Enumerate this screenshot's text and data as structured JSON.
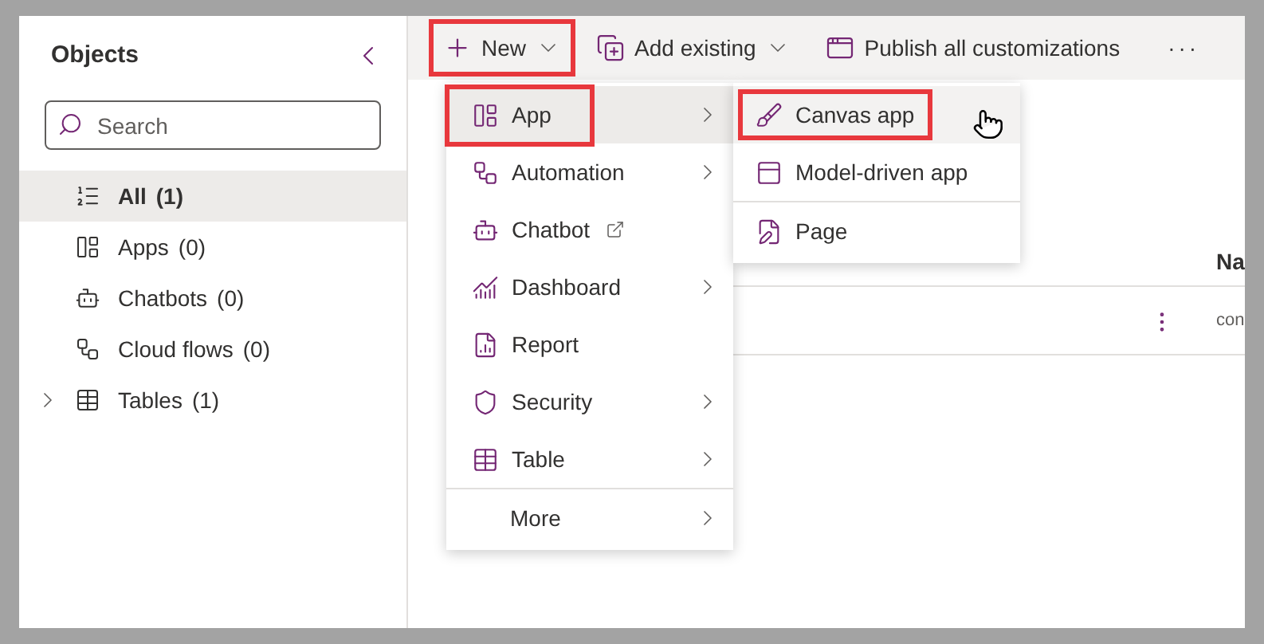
{
  "sidebar": {
    "title": "Objects",
    "search": {
      "placeholder": "Search"
    },
    "items": [
      {
        "label": "All",
        "count": "(1)",
        "selected": true,
        "kind": "list",
        "expandable": false
      },
      {
        "label": "Apps",
        "count": "(0)",
        "selected": false,
        "kind": "apps",
        "expandable": false
      },
      {
        "label": "Chatbots",
        "count": "(0)",
        "selected": false,
        "kind": "bot",
        "expandable": false
      },
      {
        "label": "Cloud flows",
        "count": "(0)",
        "selected": false,
        "kind": "flow",
        "expandable": false
      },
      {
        "label": "Tables",
        "count": "(1)",
        "selected": false,
        "kind": "table",
        "expandable": true
      }
    ]
  },
  "toolbar": {
    "items": [
      {
        "label": "New",
        "kind": "new",
        "highlighted": true,
        "dropdown": true
      },
      {
        "label": "Add existing",
        "kind": "add",
        "highlighted": false,
        "dropdown": true
      },
      {
        "label": "Publish all customizations",
        "kind": "publish",
        "highlighted": false,
        "dropdown": false
      }
    ],
    "more": "···"
  },
  "table": {
    "column_header": "Na",
    "row_cell": "con"
  },
  "menu": {
    "items": [
      {
        "label": "App",
        "kind": "apps",
        "selected": true,
        "highlighted": true,
        "submenu": true,
        "external": false
      },
      {
        "label": "Automation",
        "kind": "flow",
        "selected": false,
        "highlighted": false,
        "submenu": true,
        "external": false
      },
      {
        "label": "Chatbot",
        "kind": "bot",
        "selected": false,
        "highlighted": false,
        "submenu": false,
        "external": true
      },
      {
        "label": "Dashboard",
        "kind": "dashboard",
        "selected": false,
        "highlighted": false,
        "submenu": true,
        "external": false
      },
      {
        "label": "Report",
        "kind": "report",
        "selected": false,
        "highlighted": false,
        "submenu": false,
        "external": false
      },
      {
        "label": "Security",
        "kind": "shield",
        "selected": false,
        "highlighted": false,
        "submenu": true,
        "external": false
      },
      {
        "label": "Table",
        "kind": "table",
        "selected": false,
        "highlighted": false,
        "submenu": true,
        "external": false
      },
      {
        "label": "More",
        "kind": "none",
        "selected": false,
        "highlighted": false,
        "submenu": true,
        "external": false
      }
    ]
  },
  "submenu": {
    "items": [
      {
        "label": "Canvas app",
        "kind": "brush",
        "selected": true,
        "highlighted": true
      },
      {
        "label": "Model-driven app",
        "kind": "form",
        "selected": false,
        "highlighted": false
      },
      {
        "label": "Page",
        "kind": "page",
        "selected": false,
        "highlighted": false
      }
    ]
  }
}
